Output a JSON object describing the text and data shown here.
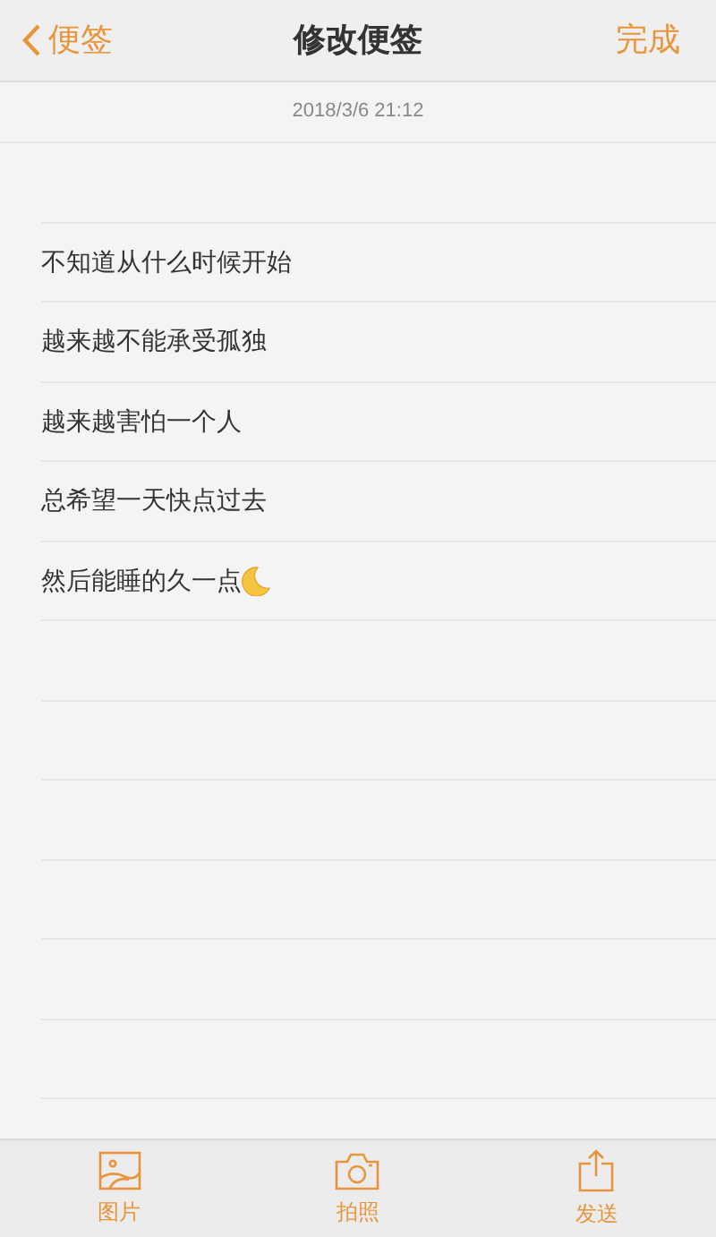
{
  "nav": {
    "back": "便签",
    "title": "修改便签",
    "done": "完成"
  },
  "date": "2018/3/6 21:12",
  "lines": [
    {
      "text": "不知道从什么时候开始",
      "moon": false
    },
    {
      "text": "越来越不能承受孤独",
      "moon": false
    },
    {
      "text": "越来越害怕一个人",
      "moon": false
    },
    {
      "text": "总希望一天快点过去",
      "moon": false
    },
    {
      "text": "然后能睡的久一点",
      "moon": true
    }
  ],
  "toolbar": [
    {
      "kind": "image",
      "label": "图片"
    },
    {
      "kind": "camera",
      "label": "拍照"
    },
    {
      "kind": "share",
      "label": "发送"
    }
  ]
}
